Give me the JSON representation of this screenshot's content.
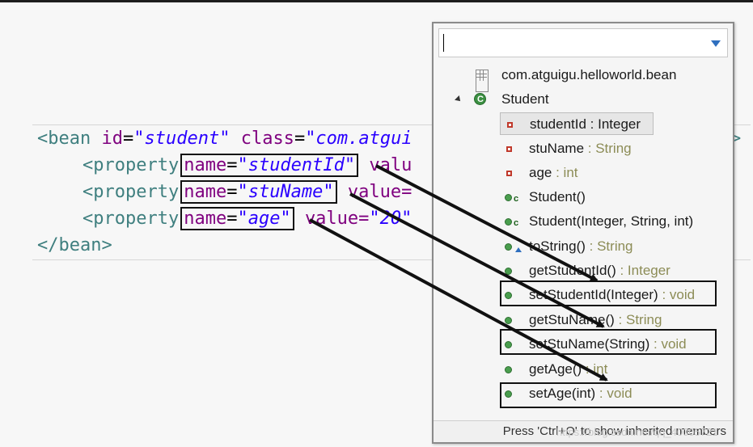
{
  "editor": {
    "lines": [
      {
        "open": "<",
        "tag": "bean",
        "attr1": "id",
        "val1": "\"student\"",
        "attr2": "class",
        "val2": "\"com.atgui"
      },
      {
        "tag": "<property",
        "attr": "name",
        "val": "\"studentId\"",
        "tail": "valu"
      },
      {
        "tag": "<property",
        "attr": "name",
        "val": "\"stuName\"",
        "tail": "value="
      },
      {
        "tag": "<property",
        "attr": "name",
        "val": "\"age\"",
        "tail": "value=",
        "tail_val": "\"20\""
      },
      {
        "close": "</bean>"
      }
    ],
    "eq": "=",
    "gt_right": ">"
  },
  "popup": {
    "filter": {
      "value": "",
      "placeholder": ""
    },
    "package": "com.atguigu.helloworld.bean",
    "class_name": "Student",
    "members": [
      {
        "name": "studentId",
        "type": " : Integer",
        "kind": "field",
        "selected": true
      },
      {
        "name": "stuName",
        "type": " : String",
        "kind": "field"
      },
      {
        "name": "age",
        "type": " : int",
        "kind": "field"
      },
      {
        "name": "Student()",
        "type": "",
        "kind": "constructor"
      },
      {
        "name": "Student(Integer, String, int)",
        "type": "",
        "kind": "constructor"
      },
      {
        "name": "toString()",
        "type": " : String",
        "kind": "method-override"
      },
      {
        "name": "getStudentId()",
        "type": " : Integer",
        "kind": "method"
      },
      {
        "name": "setStudentId(Integer)",
        "type": " : void",
        "kind": "method"
      },
      {
        "name": "getStuName()",
        "type": " : String",
        "kind": "method"
      },
      {
        "name": "setStuName(String)",
        "type": " : void",
        "kind": "method"
      },
      {
        "name": "getAge()",
        "type": " : int",
        "kind": "method"
      },
      {
        "name": "setAge(int)",
        "type": " : void",
        "kind": "method"
      }
    ],
    "status": "Press 'Ctrl+O' to show inherited members"
  },
  "watermark": "https://blog.csdn.net/qq_40005721"
}
